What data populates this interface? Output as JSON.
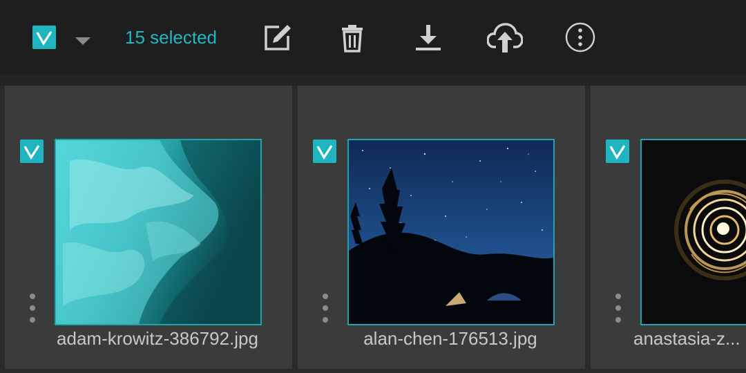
{
  "toolbar": {
    "selection_count": "15 selected",
    "select_all_checked": true,
    "icons": [
      "checkbox-checked-icon",
      "chevron-down-icon",
      "edit-icon",
      "trash-icon",
      "download-icon",
      "cloud-upload-icon",
      "more-vertical-icon"
    ]
  },
  "colors": {
    "accent": "#1fb5c0",
    "toolbar_bg": "#1e1e1e",
    "card_bg": "#3b3b3b",
    "text": "#c8c8c8"
  },
  "gallery": {
    "items": [
      {
        "filename": "adam-krowitz-386792.jpg",
        "selected": true,
        "thumb": "aerial-ocean-surf"
      },
      {
        "filename": "alan-chen-176513.jpg",
        "selected": true,
        "thumb": "night-sky-tent"
      },
      {
        "filename": "anastasia-z...",
        "selected": true,
        "thumb": "light-swirl"
      }
    ]
  }
}
